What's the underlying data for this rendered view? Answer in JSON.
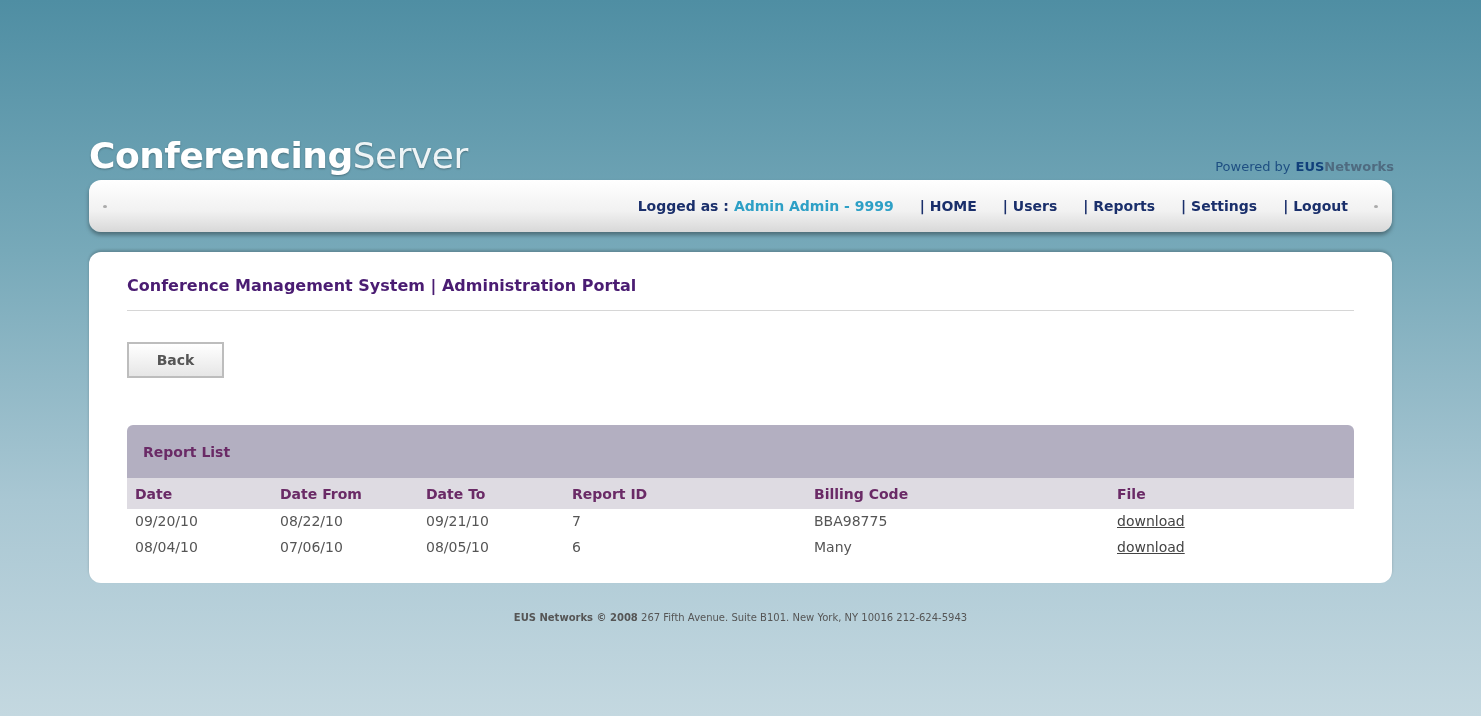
{
  "logo": {
    "strong": "Conferencing",
    "light": "Server"
  },
  "powered_by": {
    "prefix": "Powered by",
    "brand_strong": "EUS",
    "brand_light": "Networks"
  },
  "nav": {
    "logged_label": "Logged as :",
    "user": "Admin Admin - 9999",
    "links": [
      "| HOME",
      "| Users",
      "| Reports",
      "| Settings",
      "| Logout"
    ]
  },
  "page_title": "Conference Management System | Administration Portal",
  "back_button": "Back",
  "report_list": {
    "title": "Report List",
    "columns": [
      "Date",
      "Date From",
      "Date To",
      "Report ID",
      "Billing Code",
      "File"
    ],
    "rows": [
      [
        "09/20/10",
        "08/22/10",
        "09/21/10",
        "7",
        "BBA98775",
        "download"
      ],
      [
        "08/04/10",
        "07/06/10",
        "08/05/10",
        "6",
        "Many",
        "download"
      ]
    ]
  },
  "footer": "**EUS Networks © 2008** 267 Fifth Avenue. Suite B101. New York, NY 10016 212-624-5943"
}
